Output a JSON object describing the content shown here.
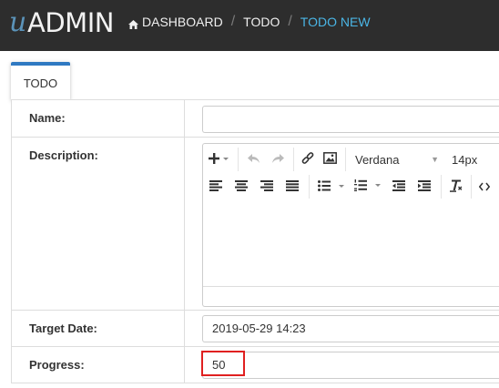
{
  "brand": {
    "u": "u",
    "admin": "ADMIN"
  },
  "breadcrumb": {
    "items": [
      {
        "label": "DASHBOARD",
        "icon": "home-icon"
      },
      {
        "label": "TODO"
      },
      {
        "label": "TODO NEW",
        "active": true
      }
    ],
    "separator": "/"
  },
  "tabs": [
    {
      "label": "TODO"
    }
  ],
  "form": {
    "name": {
      "label": "Name:",
      "value": ""
    },
    "description": {
      "label": "Description:",
      "editor": {
        "font_family": "Verdana",
        "font_size": "14px",
        "toolbar_row1": [
          "plus-icon",
          "undo-icon",
          "redo-icon",
          "link-icon",
          "image-icon",
          "font-family-select",
          "font-size-select"
        ],
        "toolbar_row2": [
          "align-left-icon",
          "align-center-icon",
          "align-right-icon",
          "align-justify-icon",
          "bullet-list-icon",
          "numbered-list-icon",
          "outdent-icon",
          "indent-icon",
          "clear-format-icon",
          "code-icon"
        ]
      }
    },
    "target_date": {
      "label": "Target Date:",
      "value": "2019-05-29 14:23"
    },
    "progress": {
      "label": "Progress:",
      "value": "50"
    }
  },
  "colors": {
    "topbar": "#2d2d2d",
    "active_breadcrumb": "#4ab5e5",
    "tab_accent": "#2f79c2",
    "highlight": "#e02020"
  }
}
